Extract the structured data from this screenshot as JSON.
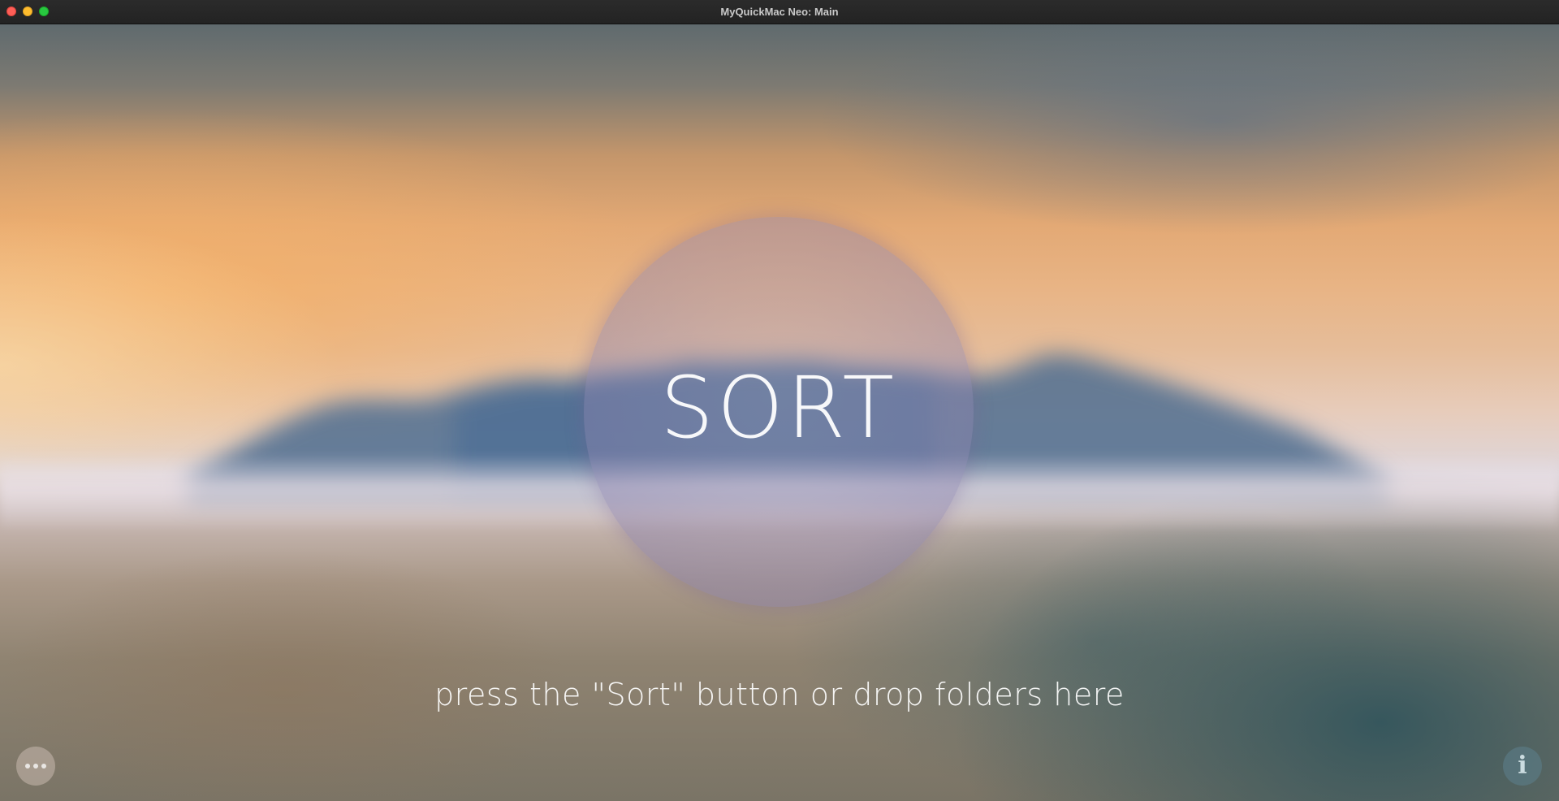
{
  "window": {
    "title": "MyQuickMac Neo: Main"
  },
  "main": {
    "sort_button_label": "SORT",
    "hint_text": "press the \"Sort\" button or drop folders here"
  },
  "corner_buttons": {
    "more_icon": "ellipsis-icon",
    "info_icon": "info-icon",
    "info_glyph": "i"
  },
  "colors": {
    "close": "#fe5f57",
    "minimize": "#febc2e",
    "maximize": "#28c840",
    "text": "#ffffff"
  }
}
